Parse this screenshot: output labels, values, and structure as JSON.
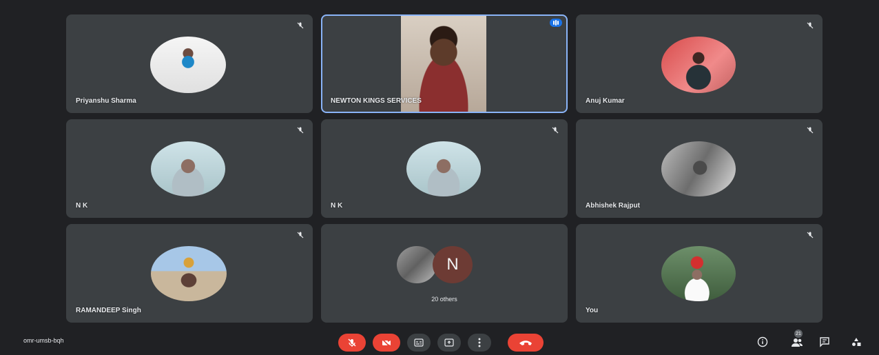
{
  "participants": [
    {
      "name": "Priyanshu Sharma"
    },
    {
      "name": "NEWTON KINGS SERVICES"
    },
    {
      "name": "Anuj Kumar"
    },
    {
      "name": "N K"
    },
    {
      "name": "N K"
    },
    {
      "name": "Abhishek Rajput"
    },
    {
      "name": "RAMANDEEP Singh"
    },
    {
      "name": "You"
    }
  ],
  "others_tile": {
    "initial": "N",
    "label": "20 others"
  },
  "meeting": {
    "code": "omr-umsb-bqh"
  },
  "participants_badge": "21",
  "controls": [
    "mic-off-icon",
    "camera-off-icon",
    "captions-icon",
    "present-icon",
    "more-icon",
    "leave-call-icon"
  ],
  "colors": {
    "background": "#202124",
    "tile": "#3c4043",
    "danger": "#ea4335",
    "speaking": "#8ab4f8"
  }
}
